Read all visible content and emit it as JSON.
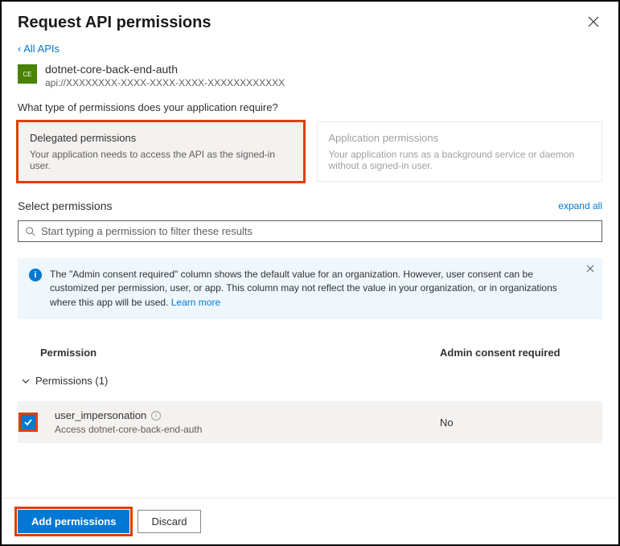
{
  "header": {
    "title": "Request API permissions"
  },
  "back_link": "‹ All APIs",
  "api": {
    "icon_text": "CE",
    "name": "dotnet-core-back-end-auth",
    "uri": "api://XXXXXXXX-XXXX-XXXX-XXXX-XXXXXXXXXXXX"
  },
  "question": "What type of permissions does your application require?",
  "perm_types": {
    "delegated": {
      "title": "Delegated permissions",
      "desc": "Your application needs to access the API as the signed-in user."
    },
    "application": {
      "title": "Application permissions",
      "desc": "Your application runs as a background service or daemon without a signed-in user."
    }
  },
  "select": {
    "label": "Select permissions",
    "expand": "expand all",
    "search_placeholder": "Start typing a permission to filter these results"
  },
  "info": {
    "text": "The \"Admin consent required\" column shows the default value for an organization. However, user consent can be customized per permission, user, or app. This column may not reflect the value in your organization, or in organizations where this app will be used. ",
    "link": "Learn more"
  },
  "table": {
    "col_permission": "Permission",
    "col_admin": "Admin consent required",
    "group_label": "Permissions (1)",
    "items": [
      {
        "name": "user_impersonation",
        "desc": "Access dotnet-core-back-end-auth",
        "admin_consent": "No",
        "checked": true
      }
    ]
  },
  "footer": {
    "add": "Add permissions",
    "discard": "Discard"
  }
}
